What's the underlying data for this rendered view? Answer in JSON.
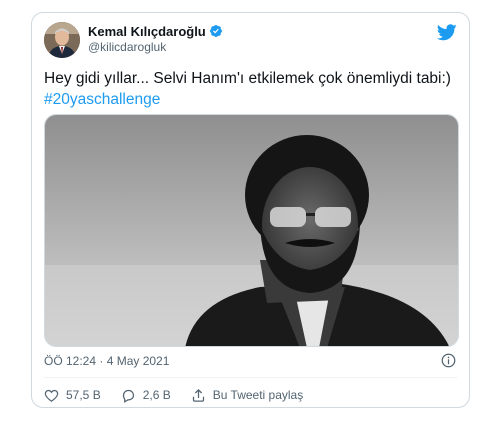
{
  "author": {
    "name": "Kemal Kılıçdaroğlu",
    "handle": "@kilicdarogluk",
    "verified_icon": "verified-badge-icon"
  },
  "brand": {
    "logo_icon": "twitter-bird-icon",
    "accent_color": "#1d9bf0"
  },
  "tweet": {
    "text": "Hey gidi yıllar... Selvi Hanım'ı etkilemek çok önemliydi tabi:)",
    "hashtag": "#20yaschallenge"
  },
  "meta": {
    "timestamp": "ÖÖ 12:24 · 4 May 2021",
    "info_icon": "info-icon"
  },
  "actions": {
    "likes": "57,5 B",
    "replies": "2,6 B",
    "share_label": "Bu Tweeti paylaş"
  }
}
